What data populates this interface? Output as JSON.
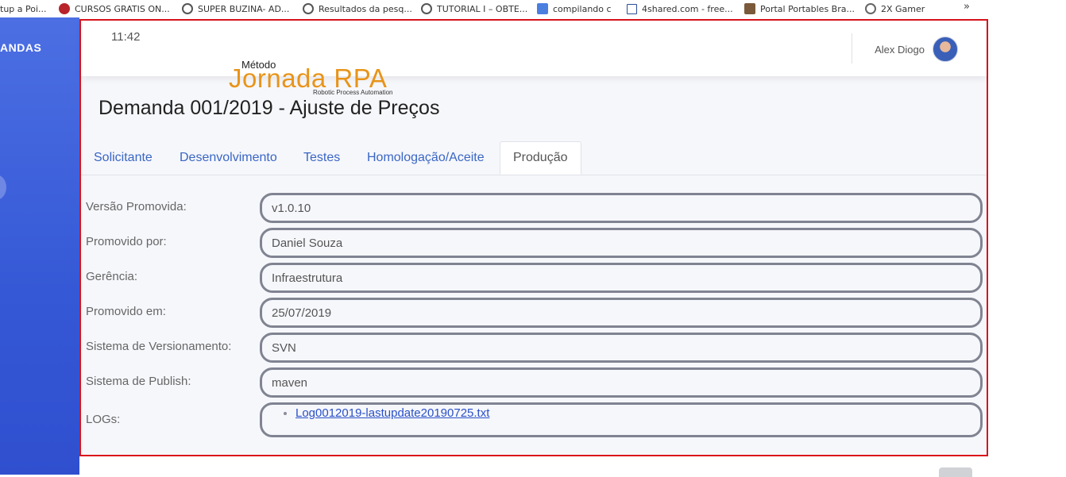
{
  "bookmarks": [
    {
      "label": "tup a Poi...",
      "icon": "none"
    },
    {
      "label": "CURSOS GRATIS ON...",
      "icon": "red-circle-icon"
    },
    {
      "label": "SUPER BUZINA- AD...",
      "icon": "globe-icon"
    },
    {
      "label": "Resultados da pesq...",
      "icon": "globe-icon"
    },
    {
      "label": "TUTORIAL I – OBTE...",
      "icon": "globe-icon"
    },
    {
      "label": "compilando c",
      "icon": "google-translate-icon"
    },
    {
      "label": "4shared.com - free...",
      "icon": "4shared-icon"
    },
    {
      "label": "Portal Portables Bra...",
      "icon": "portal-icon"
    },
    {
      "label": "2X Gamer",
      "icon": "wordpress-icon"
    }
  ],
  "bookmarks_more": "»",
  "sidebar": {
    "label": "ANDAS"
  },
  "header": {
    "time": "11:42",
    "user_name": "Alex Diogo"
  },
  "logo": {
    "top": "Método",
    "main": "Jornada RPA",
    "sub": "Robotic Process Automation"
  },
  "page_title": "Demanda 001/2019 - Ajuste de Preços",
  "tabs": [
    {
      "label": "Solicitante",
      "active": false
    },
    {
      "label": "Desenvolvimento",
      "active": false
    },
    {
      "label": "Testes",
      "active": false
    },
    {
      "label": "Homologação/Aceite",
      "active": false
    },
    {
      "label": "Produção",
      "active": true
    }
  ],
  "fields": [
    {
      "label": "Versão Promovida:",
      "value": "v1.0.10"
    },
    {
      "label": "Promovido por:",
      "value": "Daniel Souza"
    },
    {
      "label": "Gerência:",
      "value": "Infraestrutura"
    },
    {
      "label": "Promovido em:",
      "value": "25/07/2019"
    },
    {
      "label": "Sistema de Versionamento:",
      "value": "SVN"
    },
    {
      "label": "Sistema de Publish:",
      "value": "maven"
    }
  ],
  "logs": {
    "label": "LOGs:",
    "files": [
      "Log0012019-lastupdate20190725.txt"
    ]
  },
  "colors": {
    "accent": "#3a66c4",
    "logo": "#e8941a",
    "frame": "#d9141b",
    "sidebar": "#3558d6"
  }
}
